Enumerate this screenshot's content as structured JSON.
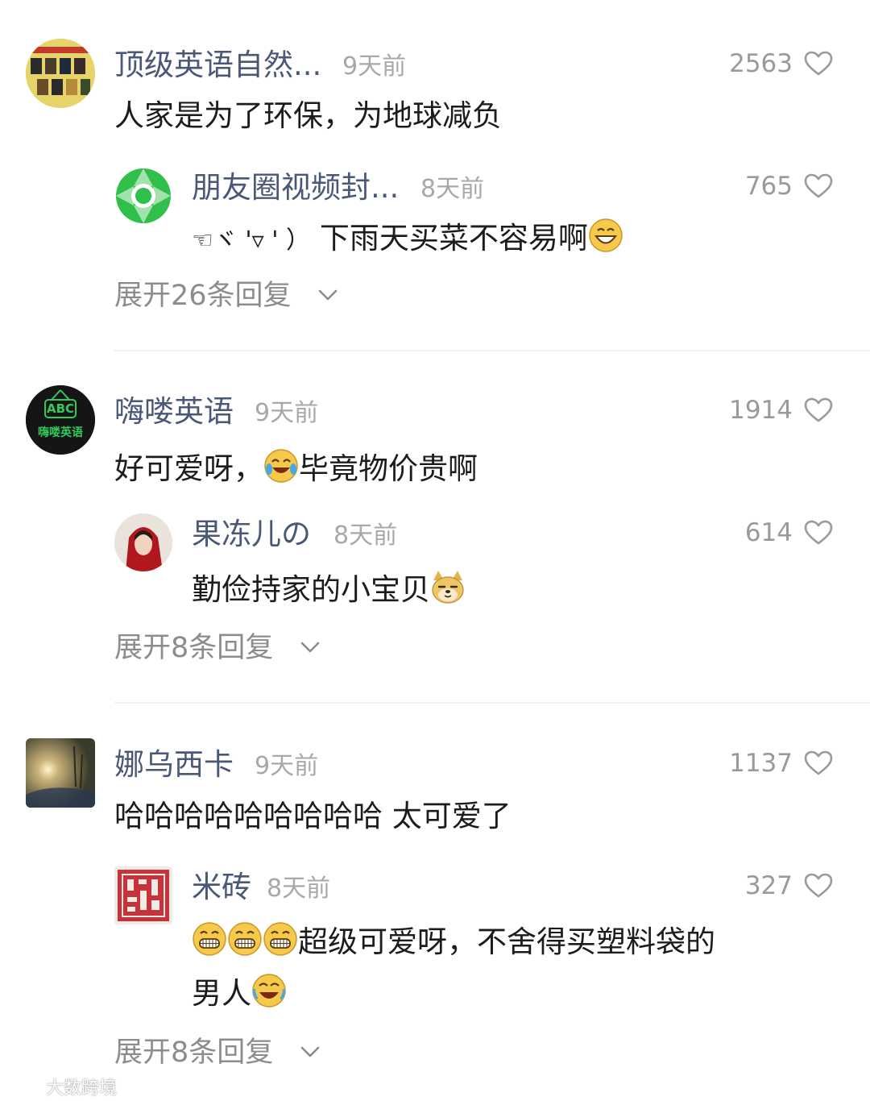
{
  "comments": [
    {
      "username": "顶级英语自然...",
      "time": "9天前",
      "likes": "2563",
      "text": "人家是为了环保，为地球减负",
      "reply": {
        "username": "朋友圈视频封...",
        "time": "8天前",
        "likes": "765",
        "text_prefix": "☜ヾ '▿ ' ）",
        "text_main": "下雨天买菜不容易啊"
      },
      "expand": "展开26条回复"
    },
    {
      "username": "嗨喽英语",
      "avatar_text_top": "ABC",
      "avatar_text_bottom": "嗨喽英语",
      "time": "9天前",
      "likes": "1914",
      "text_before": "好可爱呀，",
      "text_after": "毕竟物价贵啊",
      "reply": {
        "username": "果冻儿の",
        "time": "8天前",
        "likes": "614",
        "text": "勤俭持家的小宝贝"
      },
      "expand": "展开8条回复"
    },
    {
      "username": "娜乌西卡",
      "time": "9天前",
      "likes": "1137",
      "text": "哈哈哈哈哈哈哈哈哈 太可爱了",
      "reply": {
        "username": "米砖",
        "time": "8天前",
        "likes": "327",
        "text_line1": "超级可爱呀，不舍得买塑料袋的",
        "text_line2": "男人"
      },
      "expand": "展开8条回复"
    }
  ],
  "icons": {
    "like": "heart-outline-icon",
    "expand": "chevron-down-icon"
  },
  "colors": {
    "username": "#4a5878",
    "secondary": "#a8a8a8",
    "text": "#1c1c1c"
  },
  "watermark": "大数跨境"
}
